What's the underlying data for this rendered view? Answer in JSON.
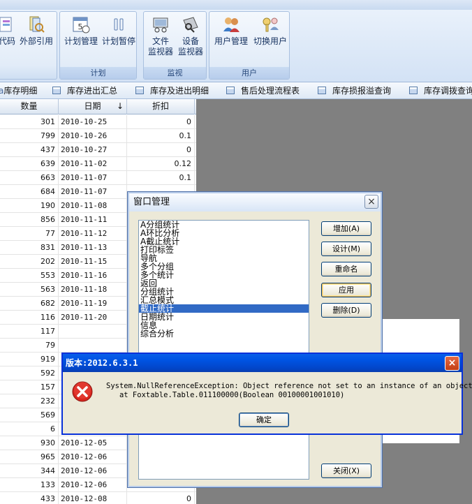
{
  "ribbon": {
    "partial_btn1": "代码",
    "partial_btn2": "外部引用",
    "groups": [
      {
        "label": "计划",
        "buttons": [
          "计划管理",
          "计划暂停"
        ]
      },
      {
        "label": "监视",
        "buttons": [
          "文件\n监视器",
          "设备\n监视器"
        ]
      },
      {
        "label": "用户",
        "buttons": [
          "用户管理",
          "切换用户"
        ]
      }
    ]
  },
  "tabs": [
    "库存明细",
    "库存进出汇总",
    "库存及进出明细",
    "售后处理流程表",
    "库存损报溢查询",
    "库存调拨查询"
  ],
  "grid": {
    "headers": [
      "数量",
      "日期",
      "折扣"
    ],
    "sort_indicator": "↓",
    "rows": [
      [
        "301",
        "2010-10-25",
        "0"
      ],
      [
        "799",
        "2010-10-26",
        "0.1"
      ],
      [
        "437",
        "2010-10-27",
        "0"
      ],
      [
        "639",
        "2010-11-02",
        "0.12"
      ],
      [
        "663",
        "2010-11-07",
        "0.1"
      ],
      [
        "684",
        "2010-11-07",
        ""
      ],
      [
        "190",
        "2010-11-08",
        ""
      ],
      [
        "856",
        "2010-11-11",
        ""
      ],
      [
        "77",
        "2010-11-12",
        ""
      ],
      [
        "831",
        "2010-11-13",
        ""
      ],
      [
        "202",
        "2010-11-15",
        ""
      ],
      [
        "553",
        "2010-11-16",
        ""
      ],
      [
        "563",
        "2010-11-18",
        ""
      ],
      [
        "682",
        "2010-11-19",
        ""
      ],
      [
        "116",
        "2010-11-20",
        ""
      ],
      [
        "117",
        "",
        ""
      ],
      [
        "79",
        "",
        ""
      ],
      [
        "919",
        "",
        ""
      ],
      [
        "592",
        "",
        ""
      ],
      [
        "157",
        "",
        ""
      ],
      [
        "232",
        "",
        ""
      ],
      [
        "569",
        "",
        ""
      ],
      [
        "6",
        "",
        ""
      ],
      [
        "930",
        "2010-12-05",
        ""
      ],
      [
        "965",
        "2010-12-06",
        ""
      ],
      [
        "344",
        "2010-12-06",
        ""
      ],
      [
        "133",
        "2010-12-06",
        ""
      ],
      [
        "433",
        "2010-12-08",
        "0"
      ]
    ]
  },
  "window_manager": {
    "title": "窗口管理",
    "close": "×",
    "items": [
      "A分组统计",
      "A环比分析",
      "A截止统计",
      "打印标签",
      "导航",
      "多个分组",
      "多个统计",
      "返回",
      "分组统计",
      "汇总模式",
      "截止统计",
      "日期统计",
      "信息",
      "综合分析"
    ],
    "selected_index": 10,
    "buttons": {
      "add": "增加(A)",
      "design": "设计(M)",
      "rename": "重命名",
      "apply": "应用",
      "delete": "删除(D)",
      "close": "关闭(X)"
    }
  },
  "error_dialog": {
    "title": "版本:2012.6.3.1",
    "close": "×",
    "message": "System.NullReferenceException: Object reference not set to an instance of an object.\n   at Foxtable.Table.011100000(Boolean 00100001001010)",
    "ok": "确定"
  }
}
